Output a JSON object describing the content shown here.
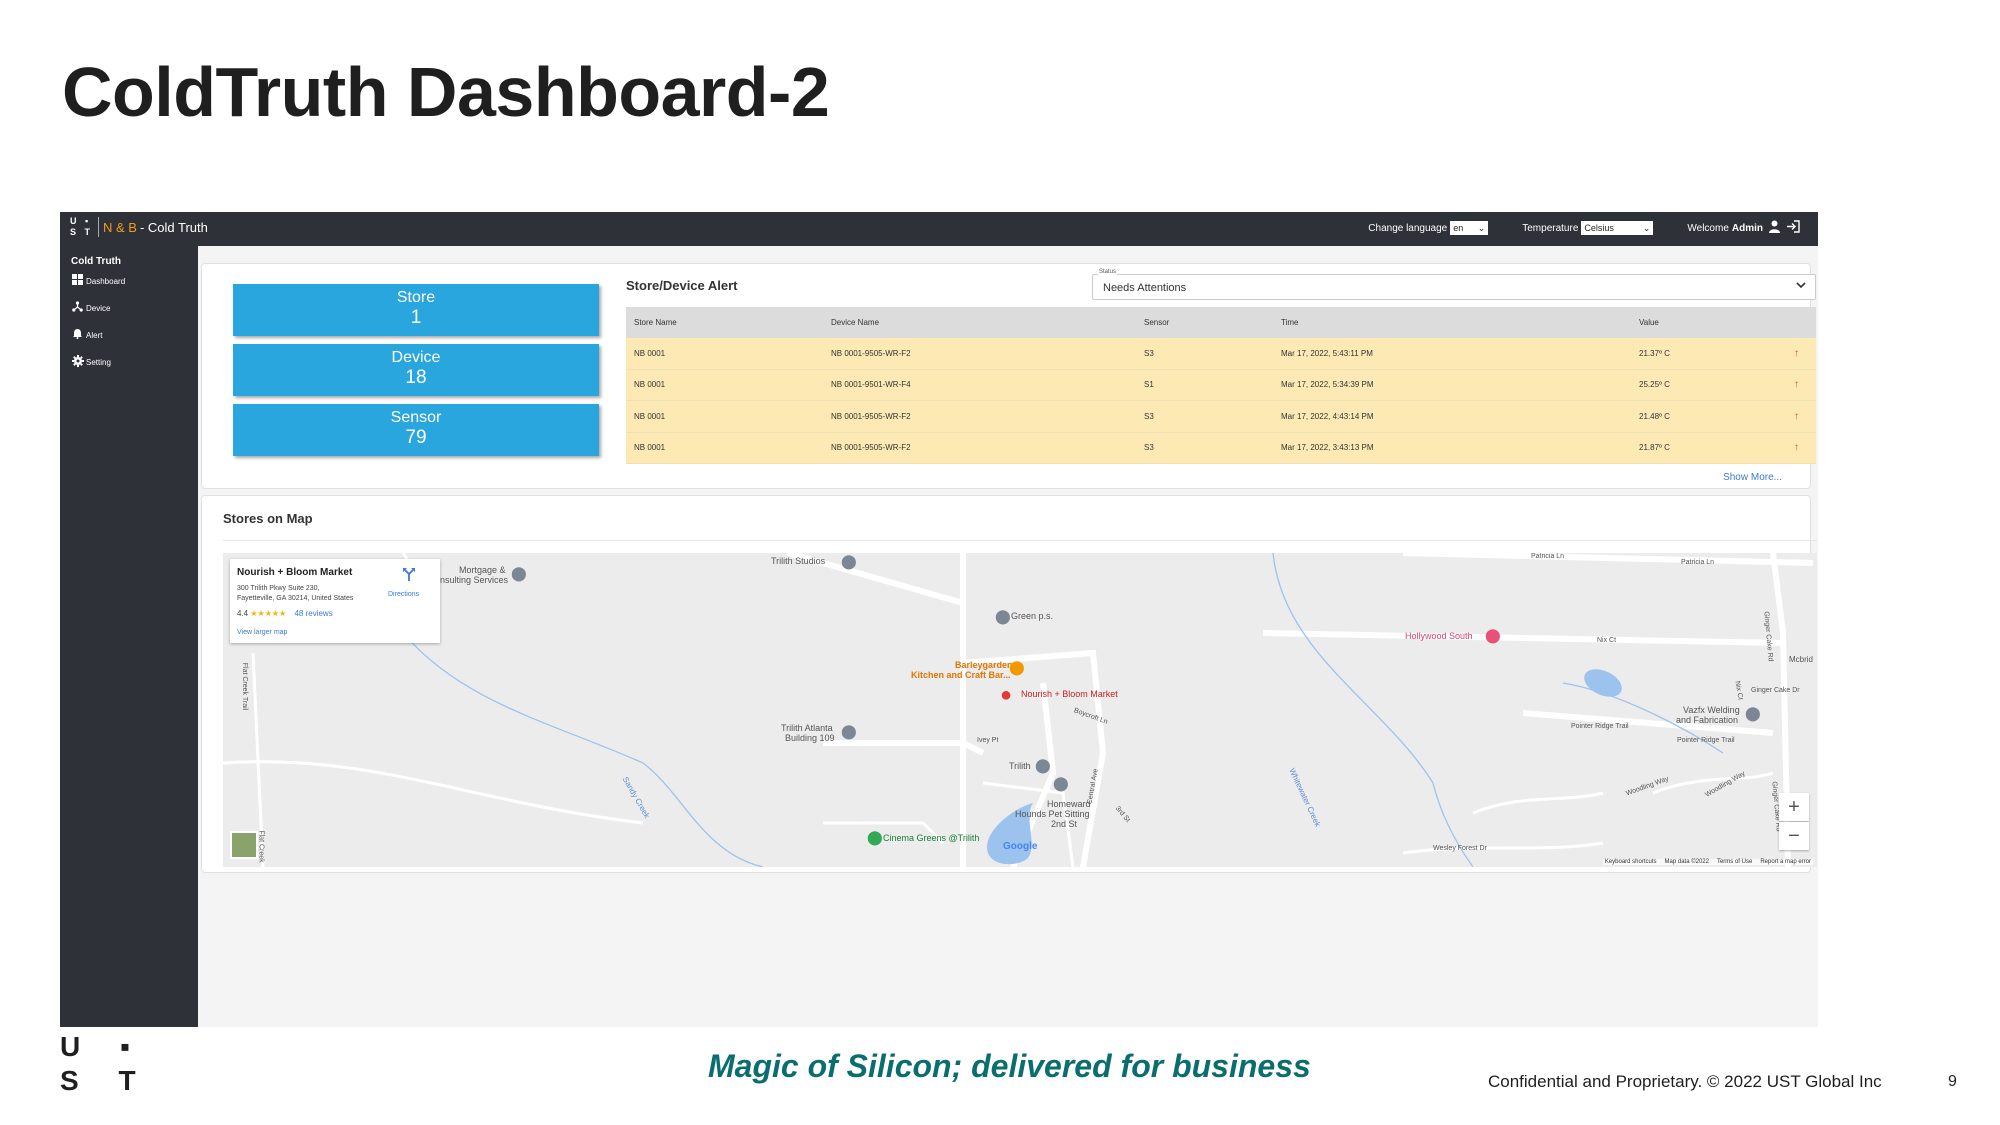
{
  "slide": {
    "title": "ColdTruth Dashboard-2",
    "tagline": "Magic of Silicon; delivered for business",
    "confidential": "Confidential and Proprietary. © 2022 UST Global Inc",
    "page_number": "9",
    "logo_top": "U ▪",
    "logo_bottom": "S T"
  },
  "topbar": {
    "brand_logo_top": "U ▪",
    "brand_logo_bottom": "S T",
    "brand_prefix": "N & B",
    "brand_name": "- Cold Truth",
    "language_label": "Change language",
    "language_value": "en",
    "temperature_label": "Temperature",
    "temperature_value": "Celsius",
    "welcome_label": "Welcome",
    "welcome_user": "Admin"
  },
  "sidebar": {
    "heading": "Cold Truth",
    "items": [
      {
        "label": "Dashboard",
        "icon": "grid-icon"
      },
      {
        "label": "Device",
        "icon": "device-icon"
      },
      {
        "label": "Alert",
        "icon": "bell-icon"
      },
      {
        "label": "Setting",
        "icon": "gear-icon"
      }
    ]
  },
  "stats": [
    {
      "label": "Store",
      "value": "1"
    },
    {
      "label": "Device",
      "value": "18"
    },
    {
      "label": "Sensor",
      "value": "79"
    }
  ],
  "alerts": {
    "title": "Store/Device Alert",
    "status_label": "Status",
    "status_value": "Needs Attentions",
    "columns": [
      "Store Name",
      "Device Name",
      "Sensor",
      "Time",
      "Value"
    ],
    "rows": [
      [
        "NB 0001",
        "NB 0001-9505-WR-F2",
        "S3",
        "Mar 17, 2022, 5:43:11 PM",
        "21.37º C"
      ],
      [
        "NB 0001",
        "NB 0001-9501-WR-F4",
        "S1",
        "Mar 17, 2022, 5:34:39 PM",
        "25.25º C"
      ],
      [
        "NB 0001",
        "NB 0001-9505-WR-F2",
        "S3",
        "Mar 17, 2022, 4:43:14 PM",
        "21.48º C"
      ],
      [
        "NB 0001",
        "NB 0001-9505-WR-F2",
        "S3",
        "Mar 17, 2022, 3:43:13 PM",
        "21.87º C"
      ]
    ],
    "trend_symbol": "↑",
    "show_more": "Show More..."
  },
  "map": {
    "title": "Stores on Map",
    "info": {
      "name": "Nourish + Bloom Market",
      "address_line1": "300 Trilith Pkwy Suite 230,",
      "address_line2": "Fayetteville, GA 30214, United States",
      "rating": "4.4",
      "stars": "★★★★★",
      "reviews": "48 reviews",
      "larger_map": "View larger map",
      "directions": "Directions"
    },
    "labels": {
      "trilith_studios": "Trilith Studios",
      "mortgage": "Mortgage &",
      "consulting": "nsulting Services",
      "green_ps": "Green p.s.",
      "barleygarden1": "Barleygarden",
      "barleygarden2": "Kitchen and Craft Bar...",
      "nourish": "Nourish + Bloom Market",
      "trilith_atlanta1": "Trilith Atlanta",
      "trilith_atlanta2": "Building 109",
      "trilith": "Trilith",
      "homeward1": "Homeward",
      "homeward2": "Hounds Pet Sitting",
      "second_st": "2nd St",
      "cinema": "Cinema Greens @Trilith",
      "hollywood": "Hollywood South",
      "vazfx1": "Vazfx Welding",
      "vazfx2": "and Fabrication",
      "nix_ct": "Nix Ct",
      "pointer1": "Pointer Ridge Trail",
      "pointer2": "Pointer Ridge Trail",
      "ginger": "Ginger Cake Dr",
      "patricia1": "Patricia Ln",
      "patricia2": "Patricia Ln",
      "mcbrid": "Mcbrid",
      "flat_creek": "Flat Creek Trail",
      "flat_creek2": "Flat Creek",
      "sandy_creek": "Sandy Creek",
      "whitewater": "Whitewater Creek",
      "boycroft": "Boycroft Ln",
      "ivey": "Ivey Pt",
      "central": "Central Ave",
      "third": "3rd St",
      "woodling1": "Woodling Way",
      "woodling2": "Woodling Way",
      "wesley": "Wesley Forest Dr",
      "ginger_rd1": "Ginger Cake Rd",
      "ginger_rd2": "Ginger Cake Rd",
      "nix_ct2": "Nix Ct"
    },
    "google": "Google",
    "zoom_in": "+",
    "zoom_out": "−",
    "footer": [
      "Keyboard shortcuts",
      "Map data ©2022",
      "Terms of Use",
      "Report a map error"
    ]
  }
}
